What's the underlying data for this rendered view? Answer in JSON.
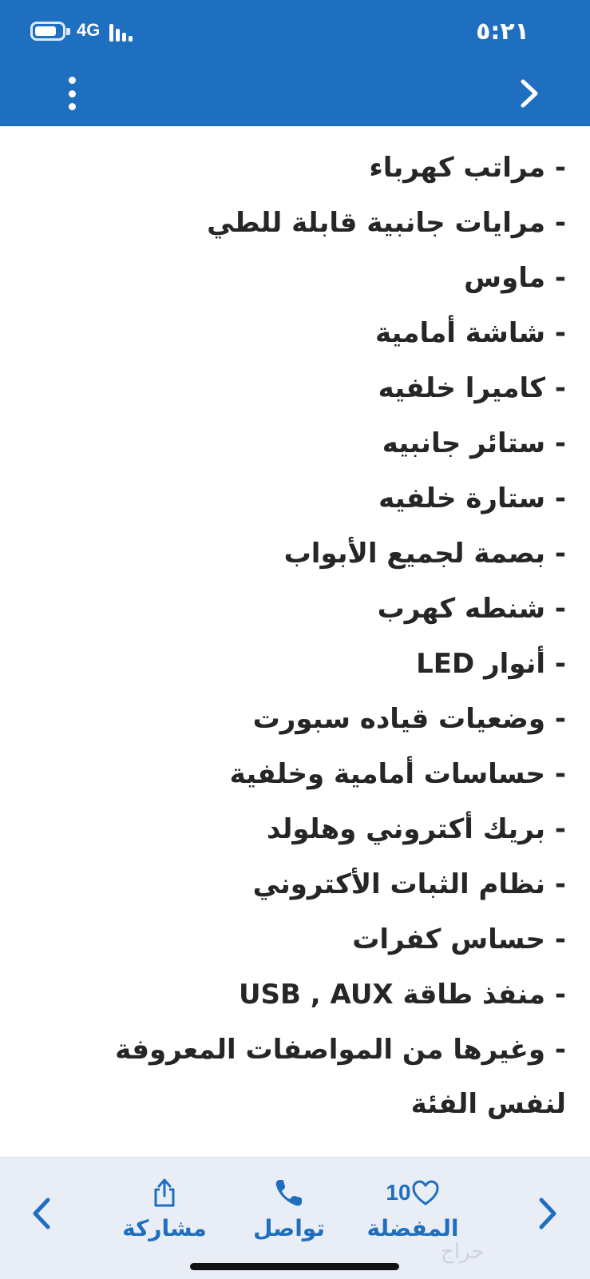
{
  "status_bar": {
    "time": "٥:٢١",
    "network": "4G",
    "battery_level": 0.8
  },
  "header": {
    "background_color": "#1f6fc0",
    "menu_icon": "more-vertical-icon",
    "forward_icon": "chevron-right-icon"
  },
  "features": [
    "- مراتب كهرباء",
    "- مرايات جانبية قابلة للطي",
    "- ماوس",
    "- شاشة أمامية",
    "- كاميرا خلفيه",
    "- ستائر جانبيه",
    "- ستارة خلفيه",
    "- بصمة لجميع الأبواب",
    "- شنطه كهرب",
    "- أنوار LED",
    "- وضعيات قياده سبورت",
    "- حساسات أمامية وخلفية",
    "- بريك أكتروني وهلولد",
    "- نظام الثبات الأكتروني",
    "- حساس كفرات",
    "- منفذ طاقة USB , AUX",
    "- وغيرها من المواصفات المعروفة لنفس الفئة"
  ],
  "bottom_bar": {
    "favorite_label": "المفضلة",
    "favorite_count": "10",
    "contact_label": "تواصل",
    "share_label": "مشاركة",
    "watermark": "حراج",
    "accent_color": "#1f6fc0"
  }
}
